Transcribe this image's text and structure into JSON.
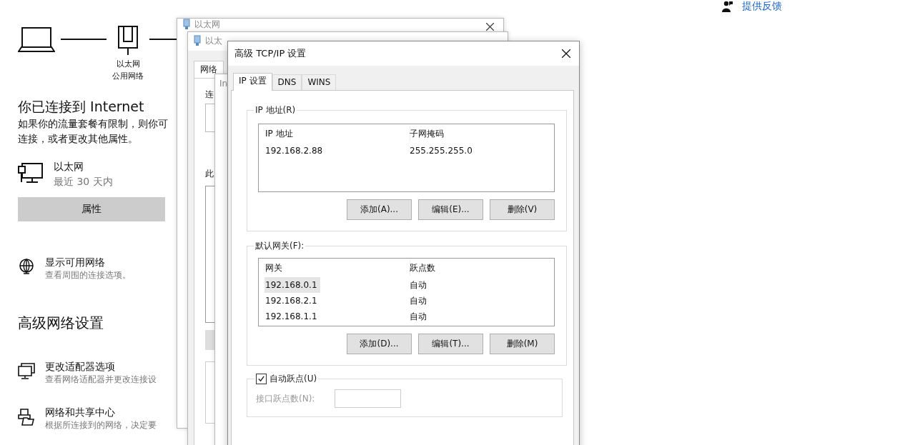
{
  "feedback_link": "提供反馈",
  "network_diagram": {
    "adapter_name": "以太网",
    "network_type": "公用网络"
  },
  "status": {
    "heading": "你已连接到 Internet",
    "description_lines": [
      "如果你的流量套餐有限制，则你可",
      "连接，或者更改其他属性。"
    ]
  },
  "connection": {
    "name": "以太网",
    "subtitle": "最近 30 天内",
    "button": "属性"
  },
  "show_networks": {
    "title": "显示可用网络",
    "subtitle": "查看周围的连接选项。"
  },
  "advanced": {
    "heading": "高级网络设置",
    "items": [
      {
        "kind": "adapter",
        "title": "更改适配器选项",
        "subtitle": "查看网络适配器并更改连接设"
      },
      {
        "kind": "sharing",
        "title": "网络和共享中心",
        "subtitle": "根据所连接到的网络，决定要"
      }
    ]
  },
  "back_windows": [
    {
      "title": "以太网"
    },
    {
      "title": "以太",
      "tab": "网络",
      "labels": [
        "连",
        "此"
      ]
    },
    {
      "tab": "In"
    }
  ],
  "dialog": {
    "title": "高级 TCP/IP 设置",
    "tabs": [
      {
        "label": "IP 设置",
        "selected": true
      },
      {
        "label": "DNS",
        "selected": false
      },
      {
        "label": "WINS",
        "selected": false
      }
    ],
    "ip_group": {
      "title": "IP 地址(R)",
      "columns": [
        "IP 地址",
        "子网掩码"
      ],
      "rows": [
        {
          "cells": [
            "192.168.2.88",
            "255.255.255.0"
          ],
          "selected": false
        }
      ],
      "buttons": [
        "添加(A)...",
        "编辑(E)...",
        "删除(V)"
      ]
    },
    "gateway_group": {
      "title": "默认网关(F):",
      "columns": [
        "网关",
        "跃点数"
      ],
      "rows": [
        {
          "cells": [
            "192.168.0.1",
            "自动"
          ],
          "selected": true
        },
        {
          "cells": [
            "192.168.2.1",
            "自动"
          ],
          "selected": false
        },
        {
          "cells": [
            "192.168.1.1",
            "自动"
          ],
          "selected": false
        }
      ],
      "buttons": [
        "添加(D)...",
        "编辑(T)...",
        "删除(M)"
      ]
    },
    "auto_metric": {
      "label": "自动跃点(U)",
      "checked": true
    },
    "interface_metric": {
      "label": "接口跃点数(N):",
      "disabled": true
    }
  }
}
